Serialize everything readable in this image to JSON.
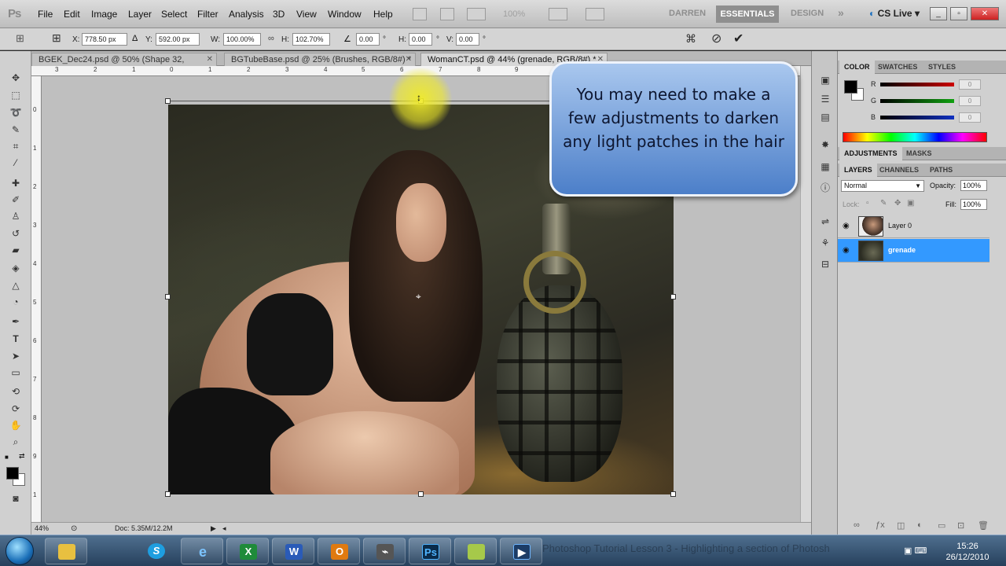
{
  "app": {
    "logo": "Ps",
    "menu": [
      "File",
      "Edit",
      "Image",
      "Layer",
      "Select",
      "Filter",
      "Analysis",
      "3D",
      "View",
      "Window",
      "Help"
    ],
    "zoom_display": "100%",
    "workspaces": {
      "darren": "DARREN",
      "essentials": "ESSENTIALS",
      "design": "DESIGN",
      "more": "»"
    },
    "cs_live": "CS Live"
  },
  "options": {
    "x_label": "X:",
    "x_value": "778.50 px",
    "y_label": "Y:",
    "y_value": "592.00 px",
    "w_label": "W:",
    "w_value": "100.00%",
    "h_label": "H:",
    "h_value": "102.70%",
    "angle_value": "0.00",
    "angle_unit": "°",
    "hskew_label": "H:",
    "hskew_value": "0.00",
    "vskew_label": "V:",
    "vskew_value": "0.00"
  },
  "tabs": [
    {
      "label": "BGEK_Dec24.psd @ 50% (Shape 32, RGB/8#)"
    },
    {
      "label": "BGTubeBase.psd @ 25% (Brushes, RGB/8#) *"
    },
    {
      "label": "WomanCT.psd @ 44% (grenade, RGB/8#) *"
    }
  ],
  "rulers": {
    "horizontal": [
      "3",
      "2",
      "1",
      "0",
      "1",
      "2",
      "3",
      "4",
      "5",
      "6",
      "7",
      "8",
      "9"
    ],
    "vertical": [
      "0",
      "1",
      "2",
      "3",
      "4",
      "5",
      "6",
      "7",
      "8",
      "9",
      "1"
    ]
  },
  "callout": {
    "text": "You may need to make a few adjustments to darken any light patches in the hair"
  },
  "status": {
    "zoom": "44%",
    "doc": "Doc: 5.35M/12.2M"
  },
  "color_panel": {
    "tabs": [
      "COLOR",
      "SWATCHES",
      "STYLES"
    ],
    "r_label": "R",
    "g_label": "G",
    "b_label": "B",
    "r_value": "0",
    "g_value": "0",
    "b_value": "0",
    "colors": {
      "r": "#cc0000",
      "g": "#10a010",
      "b": "#1030c0"
    }
  },
  "adjustments_panel": {
    "tabs": [
      "ADJUSTMENTS",
      "MASKS"
    ]
  },
  "layers_panel": {
    "tabs": [
      "LAYERS",
      "CHANNELS",
      "PATHS"
    ],
    "blend_mode": "Normal",
    "opacity_label": "Opacity:",
    "opacity_value": "100%",
    "lock_label": "Lock:",
    "fill_label": "Fill:",
    "fill_value": "100%",
    "layers": [
      {
        "name": "Layer 0",
        "selected": false
      },
      {
        "name": "grenade",
        "selected": true
      }
    ]
  },
  "taskbar": {
    "ghost_text": "Photoshop Tutorial Lesson 3 - Highlighting a section of Photosh",
    "time": "15:26",
    "date": "26/12/2010",
    "items": [
      "folder",
      "skype",
      "ie",
      "excel",
      "word",
      "outlook",
      "usb",
      "photoshop",
      "notes",
      "video"
    ]
  },
  "accent": {
    "selection": "#3399ff",
    "callout": "#5b8fd6"
  }
}
